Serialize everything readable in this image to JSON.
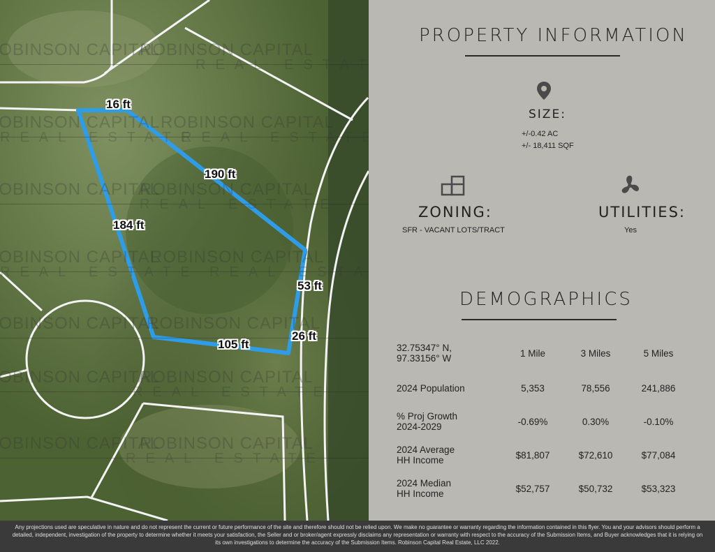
{
  "map": {
    "dimensions": [
      {
        "id": "top",
        "label": "16 ft"
      },
      {
        "id": "upper-right",
        "label": "190 ft"
      },
      {
        "id": "left",
        "label": "184 ft"
      },
      {
        "id": "right",
        "label": "53 ft"
      },
      {
        "id": "lower-right",
        "label": "26 ft"
      },
      {
        "id": "bottom",
        "label": "105 ft"
      }
    ],
    "watermark": {
      "line1": "ROBINSON CAPITAL",
      "line2": "REAL ESTATE"
    },
    "colors": {
      "boundary": "#2f9ce8",
      "road": "#f4f4f4"
    }
  },
  "property": {
    "title": "PROPERTY INFORMATION",
    "size": {
      "label": "SIZE:",
      "line1": "+/-0.42 AC",
      "line2": "+/- 18,411 SQF",
      "icon": "location-pin-icon"
    },
    "zoning": {
      "label": "ZONING:",
      "value": "SFR - VACANT LOTS/TRACT",
      "icon": "lot-layout-icon"
    },
    "utilities": {
      "label": "UTILITIES:",
      "value": "Yes",
      "icon": "fan-icon"
    }
  },
  "demographics": {
    "title": "DEMOGRAPHICS",
    "coords": {
      "line1": "32.75347° N,",
      "line2": "97.33156° W"
    },
    "columns": [
      "1 Mile",
      "3 Miles",
      "5 Miles"
    ],
    "rows": [
      {
        "label1": "2024 Population",
        "label2": "",
        "values": [
          "5,353",
          "78,556",
          "241,886"
        ]
      },
      {
        "label1": "% Proj Growth",
        "label2": "2024-2029",
        "values": [
          "-0.69%",
          "0.30%",
          "-0.10%"
        ]
      },
      {
        "label1": "2024 Average",
        "label2": "HH Income",
        "values": [
          "$81,807",
          "$72,610",
          "$77,084"
        ]
      },
      {
        "label1": "2024 Median",
        "label2": "HH Income",
        "values": [
          "$52,757",
          "$50,732",
          "$53,323"
        ]
      }
    ]
  },
  "footer": {
    "text": "Any projections used are speculative in nature and do not represent the current or future performance of the site and therefore should not be relied upon. We make no guarantee or warranty regarding the information contained in this flyer. You and your advisors should perform a detailed, independent, investigation of the property to determine whether it meets your satisfaction, the Seller and or broker/agent expressly disclaims any representation or warranty with respect to the accuracy of the Submission Items, and Buyer acknowledges that it is relying on its own investigations to determine the accuracy of the Submission Items. Robinson Capital Real Estate, LLC 2022."
  }
}
